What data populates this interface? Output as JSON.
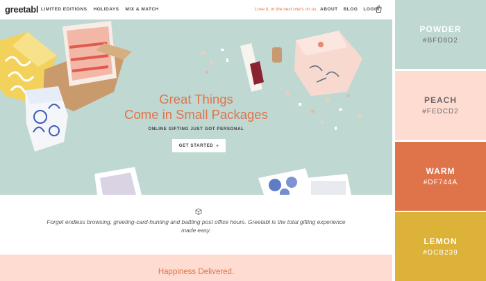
{
  "nav": {
    "logo": "greetabl",
    "links": [
      "LIMITED EDITIONS",
      "HOLIDAYS",
      "MIX & MATCH"
    ],
    "tagline": "Love it, or the next one's on us.",
    "right_links": [
      "ABOUT",
      "BLOG",
      "LOGIN"
    ],
    "bag_icon": "shopping-bag-icon"
  },
  "hero": {
    "title_line1": "Great Things",
    "title_line2": "Come in Small Packages",
    "subtitle": "ONLINE GIFTING JUST GOT PERSONAL",
    "cta_label": "GET STARTED",
    "cta_icon": "double-chevron-right-icon"
  },
  "story": {
    "icon": "gift-box-icon",
    "text": "Forget endless browsing, greeting-card-hunting and battling post office hours. Greetabl is the total gifting experience made easy."
  },
  "footer": {
    "title": "Happiness Delivered."
  },
  "palette": [
    {
      "name": "POWDER",
      "hex": "#BFD8D2",
      "color": "#BFD8D2"
    },
    {
      "name": "PEACH",
      "hex": "#FEDCD2",
      "color": "#FEDCD2"
    },
    {
      "name": "WARM",
      "hex": "#DF744A",
      "color": "#DF744A"
    },
    {
      "name": "LEMON",
      "hex": "#DCB239",
      "color": "#DCB239"
    }
  ],
  "colors": {
    "accent": "#DF744A",
    "hero_bg": "#BFD8D2",
    "footer_bg": "#FEDCD2"
  }
}
